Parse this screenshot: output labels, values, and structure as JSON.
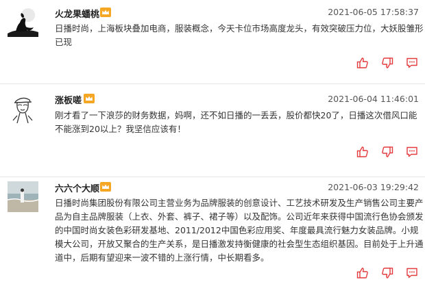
{
  "comments": [
    {
      "username": "火龙果蟠桃",
      "time": "2021-06-05 17:58:37",
      "content": "日播时尚，上海板块叠加电商，服装概念，今天卡位市场高度龙头，有效突破压力位，大妖股雏形已现"
    },
    {
      "username": "涨板嗟",
      "time": "2021-06-04 11:46:01",
      "content": "刚才看了一下浪莎的财务数据，妈啊，还不如日播的一丢丢，股价都快20了，日播这次借风口能不能涨到20以上？我坚信应该有！"
    },
    {
      "username": "六六个大顺",
      "time": "2021-06-03 19:29:42",
      "content": "日播时尚集团股份有限公司主营业务为品牌服装的创意设计、工艺技术研发及生产销售公司主要产品为自主品牌服装（上衣、外套、裤子、裙子等）以及配饰。公司近年来获得中国流行色协会颁发的中国时尚女装色彩研发基地、2011/2012中国色彩应用奖、年度最具流行魅力女装品牌。小规模大公司，开放又聚合的生产关系，是日播激发持衡健康的社会型生态组织基因。目前处于上升通道中，后期有望迎来一波不错的上涨行情，中长期看多。"
    }
  ],
  "icons": {
    "vip": "crown-icon",
    "like": "thumbs-up-icon",
    "dislike": "thumbs-down-icon",
    "reply": "comment-icon"
  },
  "colors": {
    "action_red": "#e4393c",
    "vip_gold": "#f5a623"
  }
}
